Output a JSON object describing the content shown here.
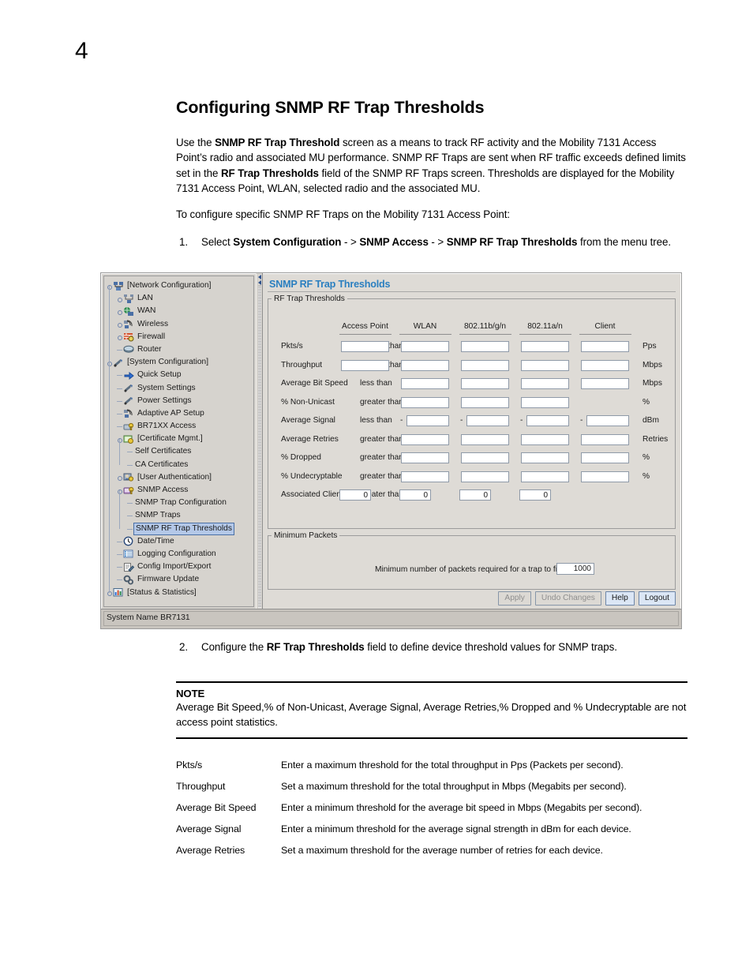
{
  "document": {
    "chapter_number": "4",
    "title": "Configuring SNMP RF Trap Thresholds",
    "intro_paragraph": {
      "part1": "Use the ",
      "bold1": "SNMP RF Trap Threshold",
      "part2": " screen as a means to track RF activity and the Mobility 7131 Access Point’s radio and associated MU performance. SNMP RF Traps are sent when RF traffic exceeds defined limits set in the ",
      "bold2": "RF Trap Thresholds",
      "part3": " field of the SNMP RF Traps screen. Thresholds are displayed for the Mobility 7131 Access Point, WLAN, selected radio and the associated MU."
    },
    "lead_in": "To configure specific SNMP RF Traps on the Mobility 7131 Access Point:",
    "step1": {
      "number": "1.",
      "part1": "Select ",
      "bold1": "System Configuration",
      "part2": " - > ",
      "bold2": "SNMP Access",
      "part3": " - > ",
      "bold3": "SNMP RF Trap Thresholds",
      "part4": " from the menu tree."
    },
    "step2": {
      "number": "2.",
      "part1": "Configure the ",
      "bold1": "RF Trap Thresholds",
      "part2": " field to define device threshold values for SNMP traps."
    },
    "note": {
      "title": "NOTE",
      "text": "Average Bit Speed,% of Non-Unicast, Average Signal, Average Retries,% Dropped and % Undecryptable are not access point statistics."
    },
    "definitions": [
      {
        "term": "Pkts/s",
        "description": "Enter a maximum threshold for the total throughput in Pps (Packets per second)."
      },
      {
        "term": "Throughput",
        "description": "Set a maximum threshold for the total throughput in Mbps (Megabits per second)."
      },
      {
        "term": "Average Bit Speed",
        "description": "Enter a minimum threshold for the average bit speed in Mbps (Megabits per second)."
      },
      {
        "term": "Average Signal",
        "description": "Enter a minimum threshold for the average signal strength in dBm for each device."
      },
      {
        "term": "Average Retries",
        "description": "Set a maximum threshold for the average number of retries for each device."
      }
    ]
  },
  "app": {
    "accent_color": "#2a7fc0",
    "panel_background": "#dedbd6",
    "selection_color": "#b4c8e8",
    "tree": {
      "items": [
        {
          "label": "[Network Configuration]",
          "depth": 0,
          "icon": "network-configuration-icon",
          "expander": true,
          "selected": false
        },
        {
          "label": "LAN",
          "depth": 1,
          "icon": "lan-icon",
          "expander": true,
          "selected": false
        },
        {
          "label": "WAN",
          "depth": 1,
          "icon": "wan-icon",
          "expander": true,
          "selected": false
        },
        {
          "label": "Wireless",
          "depth": 1,
          "icon": "wireless-icon",
          "expander": true,
          "selected": false
        },
        {
          "label": "Firewall",
          "depth": 1,
          "icon": "firewall-icon",
          "expander": true,
          "selected": false
        },
        {
          "label": "Router",
          "depth": 1,
          "icon": "router-icon",
          "expander": false,
          "selected": false
        },
        {
          "label": "[System Configuration]",
          "depth": 0,
          "icon": "system-configuration-icon",
          "expander": true,
          "selected": false
        },
        {
          "label": "Quick Setup",
          "depth": 1,
          "icon": "quick-setup-icon",
          "expander": false,
          "selected": false
        },
        {
          "label": "System Settings",
          "depth": 1,
          "icon": "system-settings-icon",
          "expander": false,
          "selected": false
        },
        {
          "label": "Power Settings",
          "depth": 1,
          "icon": "power-settings-icon",
          "expander": false,
          "selected": false
        },
        {
          "label": "Adaptive AP Setup",
          "depth": 1,
          "icon": "adaptive-ap-setup-icon",
          "expander": false,
          "selected": false
        },
        {
          "label": "BR71XX Access",
          "depth": 1,
          "icon": "br71xx-access-icon",
          "expander": false,
          "selected": false
        },
        {
          "label": "[Certificate Mgmt.]",
          "depth": 1,
          "icon": "certificate-mgmt-icon",
          "expander": true,
          "selected": false
        },
        {
          "label": "Self Certificates",
          "depth": 2,
          "icon": "none",
          "expander": false,
          "selected": false
        },
        {
          "label": "CA Certificates",
          "depth": 2,
          "icon": "none",
          "expander": false,
          "selected": false
        },
        {
          "label": "[User Authentication]",
          "depth": 1,
          "icon": "user-authentication-icon",
          "expander": true,
          "selected": false
        },
        {
          "label": "SNMP Access",
          "depth": 1,
          "icon": "snmp-access-icon",
          "expander": true,
          "selected": false
        },
        {
          "label": "SNMP Trap Configuration",
          "depth": 2,
          "icon": "none",
          "expander": false,
          "selected": false
        },
        {
          "label": "SNMP Traps",
          "depth": 2,
          "icon": "none",
          "expander": false,
          "selected": false
        },
        {
          "label": "SNMP RF Trap Thresholds",
          "depth": 2,
          "icon": "none",
          "expander": false,
          "selected": true
        },
        {
          "label": "Date/Time",
          "depth": 1,
          "icon": "clock-icon",
          "expander": false,
          "selected": false
        },
        {
          "label": "Logging Configuration",
          "depth": 1,
          "icon": "logging-icon",
          "expander": false,
          "selected": false
        },
        {
          "label": "Config Import/Export",
          "depth": 1,
          "icon": "config-import-export-icon",
          "expander": false,
          "selected": false
        },
        {
          "label": "Firmware Update",
          "depth": 1,
          "icon": "firmware-update-icon",
          "expander": false,
          "selected": false
        },
        {
          "label": "[Status & Statistics]",
          "depth": 0,
          "icon": "status-statistics-icon",
          "expander": true,
          "selected": false
        }
      ]
    },
    "panel": {
      "heading": "SNMP RF Trap Thresholds",
      "thresholds_group": {
        "legend": "RF Trap Thresholds",
        "columns": [
          "Access Point",
          "WLAN",
          "802.11b/g/n",
          "802.11a/n",
          "Client"
        ],
        "rows": [
          {
            "label": "Pkts/s",
            "operator": "greater than",
            "unit": "Pps",
            "cells": [
              {
                "shown": true,
                "value": ""
              },
              {
                "shown": true,
                "value": ""
              },
              {
                "shown": true,
                "value": ""
              },
              {
                "shown": true,
                "value": ""
              },
              {
                "shown": true,
                "value": ""
              }
            ],
            "minus": false,
            "small": false
          },
          {
            "label": "Throughput",
            "operator": "greater than",
            "unit": "Mbps",
            "cells": [
              {
                "shown": true,
                "value": ""
              },
              {
                "shown": true,
                "value": ""
              },
              {
                "shown": true,
                "value": ""
              },
              {
                "shown": true,
                "value": ""
              },
              {
                "shown": true,
                "value": ""
              }
            ],
            "minus": false,
            "small": false
          },
          {
            "label": "Average Bit Speed",
            "operator": "less than",
            "unit": "Mbps",
            "cells": [
              {
                "shown": false,
                "value": ""
              },
              {
                "shown": true,
                "value": ""
              },
              {
                "shown": true,
                "value": ""
              },
              {
                "shown": true,
                "value": ""
              },
              {
                "shown": true,
                "value": ""
              }
            ],
            "minus": false,
            "small": false
          },
          {
            "label": "% Non-Unicast",
            "operator": "greater than",
            "unit": "%",
            "cells": [
              {
                "shown": false,
                "value": ""
              },
              {
                "shown": true,
                "value": ""
              },
              {
                "shown": true,
                "value": ""
              },
              {
                "shown": true,
                "value": ""
              },
              {
                "shown": false,
                "value": ""
              }
            ],
            "minus": false,
            "small": false
          },
          {
            "label": "Average Signal",
            "operator": "less than",
            "unit": "dBm",
            "cells": [
              {
                "shown": false,
                "value": ""
              },
              {
                "shown": true,
                "value": ""
              },
              {
                "shown": true,
                "value": ""
              },
              {
                "shown": true,
                "value": ""
              },
              {
                "shown": true,
                "value": ""
              }
            ],
            "minus": true,
            "small": false
          },
          {
            "label": "Average Retries",
            "operator": "greater than",
            "unit": "Retries",
            "cells": [
              {
                "shown": false,
                "value": ""
              },
              {
                "shown": true,
                "value": ""
              },
              {
                "shown": true,
                "value": ""
              },
              {
                "shown": true,
                "value": ""
              },
              {
                "shown": true,
                "value": ""
              }
            ],
            "minus": false,
            "small": false
          },
          {
            "label": "% Dropped",
            "operator": "greater than",
            "unit": "%",
            "cells": [
              {
                "shown": false,
                "value": ""
              },
              {
                "shown": true,
                "value": ""
              },
              {
                "shown": true,
                "value": ""
              },
              {
                "shown": true,
                "value": ""
              },
              {
                "shown": true,
                "value": ""
              }
            ],
            "minus": false,
            "small": false
          },
          {
            "label": "% Undecryptable",
            "operator": "greater than",
            "unit": "%",
            "cells": [
              {
                "shown": false,
                "value": ""
              },
              {
                "shown": true,
                "value": ""
              },
              {
                "shown": true,
                "value": ""
              },
              {
                "shown": true,
                "value": ""
              },
              {
                "shown": true,
                "value": ""
              }
            ],
            "minus": false,
            "small": false
          },
          {
            "label": "Associated Clients",
            "operator": "greater than",
            "unit": "",
            "cells": [
              {
                "shown": true,
                "value": "0"
              },
              {
                "shown": true,
                "value": "0"
              },
              {
                "shown": true,
                "value": "0"
              },
              {
                "shown": true,
                "value": "0"
              },
              {
                "shown": false,
                "value": ""
              }
            ],
            "minus": false,
            "small": true
          }
        ]
      },
      "minimum_packets_group": {
        "legend": "Minimum Packets",
        "label": "Minimum number of packets required for a trap to fire",
        "value": "1000"
      },
      "buttons": [
        {
          "label": "Apply",
          "enabled": false
        },
        {
          "label": "Undo Changes",
          "enabled": false
        },
        {
          "label": "Help",
          "enabled": true
        },
        {
          "label": "Logout",
          "enabled": true
        }
      ]
    },
    "status_bar": {
      "text": "System Name BR7131"
    }
  }
}
